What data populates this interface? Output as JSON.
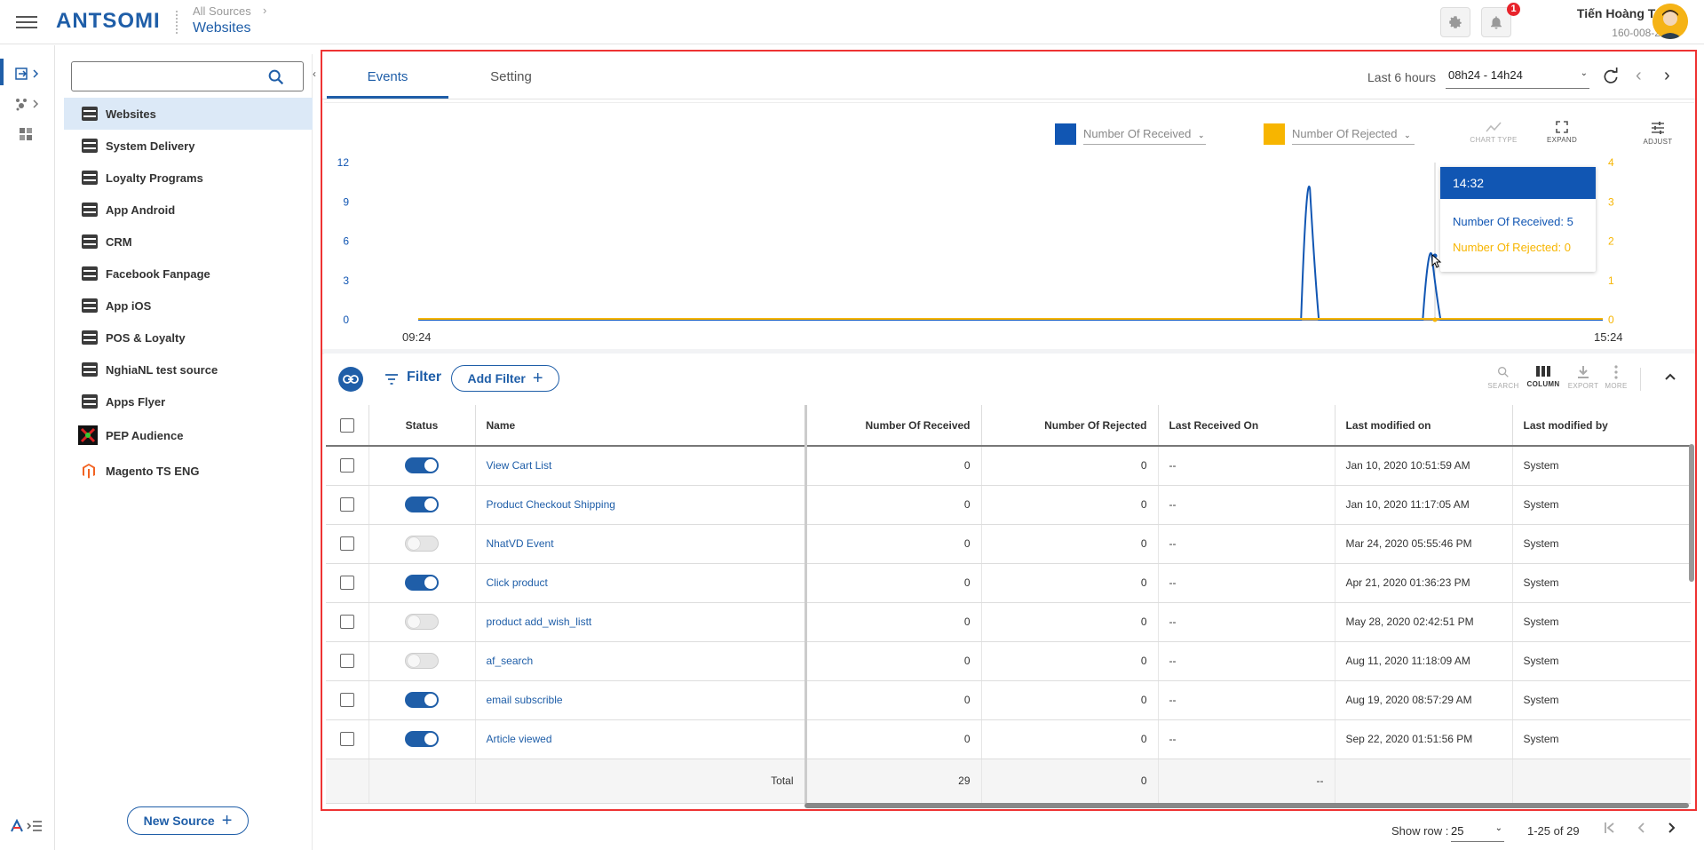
{
  "header": {
    "logo": "ANTSOMI",
    "breadcrumb_parent": "All Sources",
    "breadcrumb_current": "Websites",
    "notification_count": "1",
    "user_name": "Tiến Hoàng Trịnh",
    "user_phone": "160-008-2685"
  },
  "sidebar": {
    "search_placeholder": "",
    "items": [
      {
        "label": "Websites"
      },
      {
        "label": "System Delivery"
      },
      {
        "label": "Loyalty Programs"
      },
      {
        "label": "App Android"
      },
      {
        "label": "CRM"
      },
      {
        "label": "Facebook Fanpage"
      },
      {
        "label": "App iOS"
      },
      {
        "label": "POS & Loyalty"
      },
      {
        "label": "NghiaNL test source"
      },
      {
        "label": "Apps Flyer"
      },
      {
        "label": "PEP Audience"
      },
      {
        "label": "Magento TS ENG"
      }
    ],
    "new_source_label": "New Source"
  },
  "tabs": {
    "events": "Events",
    "setting": "Setting"
  },
  "time": {
    "label": "Last 6 hours",
    "range": "08h24 - 14h24"
  },
  "chart_legend": {
    "received": "Number Of Received",
    "rejected": "Number Of Rejected",
    "chart_type": "CHART TYPE",
    "expand": "EXPAND",
    "adjust": "ADJUST"
  },
  "chart_data": {
    "type": "line",
    "x_start_label": "09:24",
    "x_end_label": "15:24",
    "left_ticks": [
      "12",
      "9",
      "6",
      "3",
      "0"
    ],
    "right_ticks": [
      "4",
      "3",
      "2",
      "1",
      "0"
    ],
    "y_left_range": [
      0,
      12
    ],
    "y_right_range": [
      0,
      4
    ],
    "series": [
      {
        "name": "Number Of Received",
        "color": "#1156b3",
        "axis": "left",
        "peaks": [
          {
            "time": "13:55",
            "value": 10
          },
          {
            "time": "14:32",
            "value": 5
          }
        ]
      },
      {
        "name": "Number Of Rejected",
        "color": "#f7b500",
        "axis": "right",
        "peaks": []
      }
    ]
  },
  "tooltip": {
    "time": "14:32",
    "received": "Number Of Received: 5",
    "rejected": "Number Of Rejected: 0"
  },
  "toolbar": {
    "filter_label": "Filter",
    "add_filter_label": "Add Filter",
    "search": "SEARCH",
    "column": "COLUMN",
    "export": "EXPORT",
    "more": "MORE"
  },
  "table": {
    "headers": {
      "status": "Status",
      "name": "Name",
      "received": "Number Of Received",
      "rejected": "Number Of Rejected",
      "last_received": "Last Received On",
      "last_modified_on": "Last modified on",
      "last_modified_by": "Last modified by"
    },
    "rows": [
      {
        "enabled": true,
        "name": "View Cart List",
        "received": "0",
        "rejected": "0",
        "last_received": "--",
        "modified_on": "Jan 10, 2020 10:51:59 AM",
        "modified_by": "System"
      },
      {
        "enabled": true,
        "name": "Product Checkout Shipping",
        "received": "0",
        "rejected": "0",
        "last_received": "--",
        "modified_on": "Jan 10, 2020 11:17:05 AM",
        "modified_by": "System"
      },
      {
        "enabled": false,
        "name": "NhatVD Event",
        "received": "0",
        "rejected": "0",
        "last_received": "--",
        "modified_on": "Mar 24, 2020 05:55:46 PM",
        "modified_by": "System"
      },
      {
        "enabled": true,
        "name": "Click product",
        "received": "0",
        "rejected": "0",
        "last_received": "--",
        "modified_on": "Apr 21, 2020 01:36:23 PM",
        "modified_by": "System"
      },
      {
        "enabled": false,
        "name": "product add_wish_listt",
        "received": "0",
        "rejected": "0",
        "last_received": "--",
        "modified_on": "May 28, 2020 02:42:51 PM",
        "modified_by": "System"
      },
      {
        "enabled": false,
        "name": "af_search",
        "received": "0",
        "rejected": "0",
        "last_received": "--",
        "modified_on": "Aug 11, 2020 11:18:09 AM",
        "modified_by": "System"
      },
      {
        "enabled": true,
        "name": "email subscrible",
        "received": "0",
        "rejected": "0",
        "last_received": "--",
        "modified_on": "Aug 19, 2020 08:57:29 AM",
        "modified_by": "System"
      },
      {
        "enabled": true,
        "name": "Article viewed",
        "received": "0",
        "rejected": "0",
        "last_received": "--",
        "modified_on": "Sep 22, 2020 01:51:56 PM",
        "modified_by": "System"
      }
    ],
    "total": {
      "label": "Total",
      "received": "29",
      "rejected": "0",
      "last_received": "--"
    }
  },
  "footer": {
    "show_row_label": "Show row :",
    "show_row_value": "25",
    "page_info": "1-25 of 29"
  },
  "colors": {
    "accent": "#1f5ea8",
    "received": "#1156b3",
    "rejected": "#f7b500",
    "highlight_border": "#e33"
  }
}
